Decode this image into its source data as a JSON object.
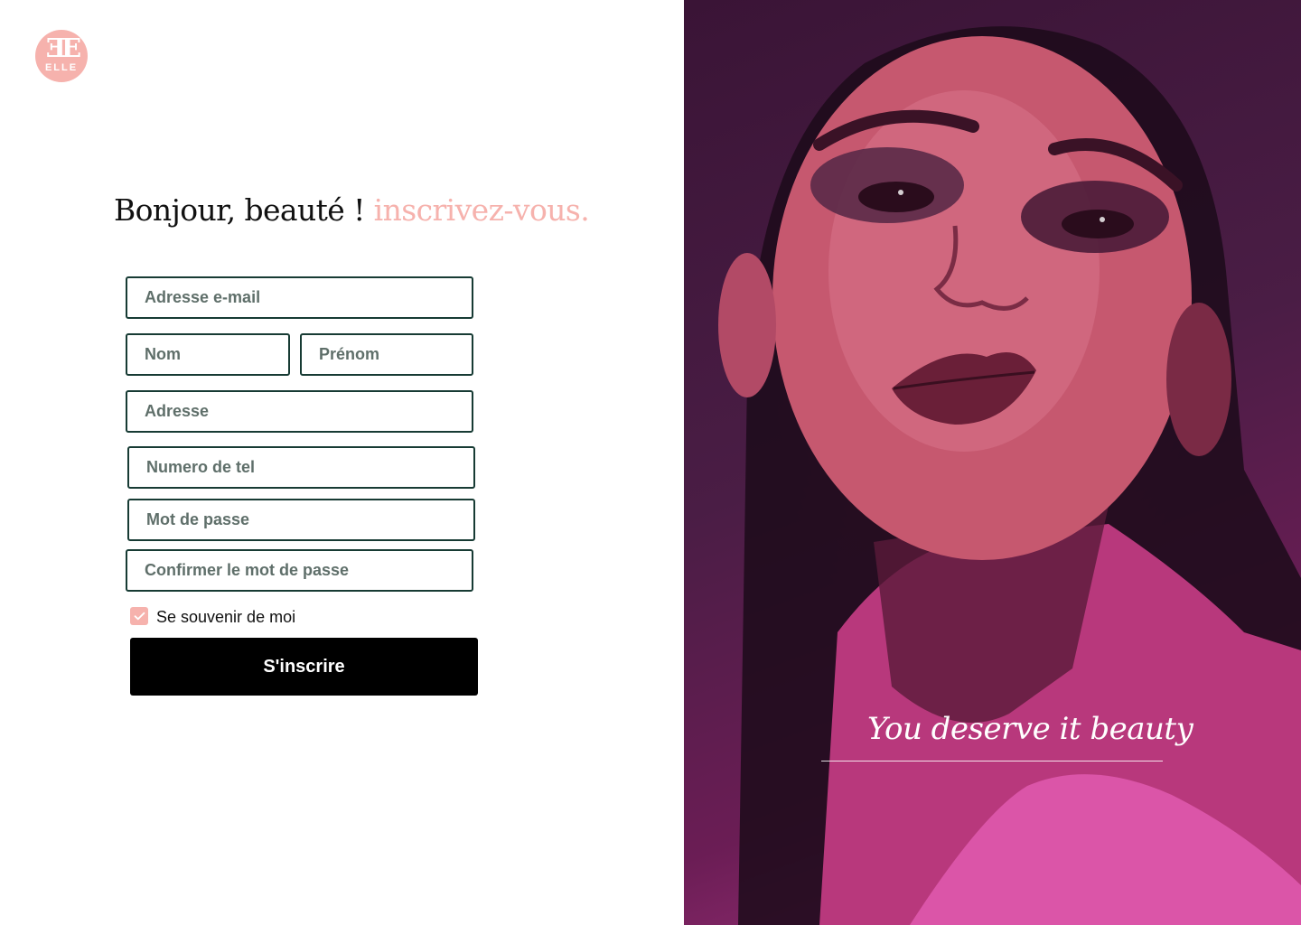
{
  "brand": {
    "mark": "ƎE",
    "name": "ELLE"
  },
  "heading": {
    "greeting": "Bonjour, beauté !",
    "accent": "inscrivez-vous."
  },
  "form": {
    "email_placeholder": "Adresse e-mail",
    "lastname_placeholder": "Nom",
    "firstname_placeholder": "Prénom",
    "address_placeholder": "Adresse",
    "phone_placeholder": "Numero de tel",
    "password_placeholder": "Mot de passe",
    "confirm_password_placeholder": "Confirmer le mot de passe",
    "remember_label": "Se souvenir de moi",
    "remember_checked": true,
    "submit_label": "S'inscrire"
  },
  "hero": {
    "tagline": "You deserve it beauty",
    "image": "woman-portrait-pink-lighting"
  },
  "colors": {
    "accent": "#f6b2ad",
    "field_border": "#173b34",
    "button": "#000000",
    "photo_tint": "#a83582"
  },
  "icons": {
    "checkbox": "check-icon"
  }
}
